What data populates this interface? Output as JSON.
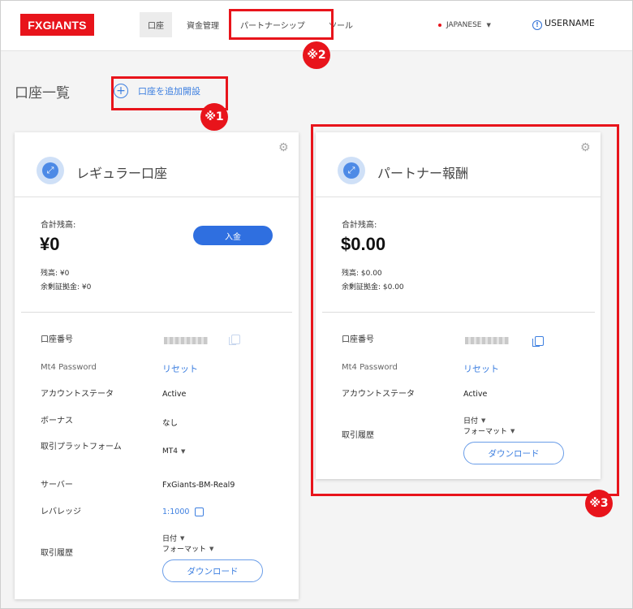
{
  "header": {
    "logo": "FXGIANTS",
    "nav": {
      "account": "口座",
      "funds": "資金管理",
      "partner": "パートナーシップ",
      "tools": "ツール"
    },
    "language": "JAPANESE",
    "username": "USERNAME",
    "info_symbol": "!"
  },
  "page": {
    "title": "口座一覧",
    "add_account": "口座を追加開設"
  },
  "annotations": {
    "one": "※1",
    "two": "※2",
    "three": "※3",
    "color": "#e8141b"
  },
  "regular_account": {
    "title": "レギュラー口座",
    "balance_label": "合計残高:",
    "balance": "¥0",
    "balance_line": "残高: ¥0",
    "margin_line": "余剰証拠金: ¥0",
    "deposit_label": "入金",
    "rows": {
      "account_number_label": "口座番号",
      "password_label": "Mt4 Password",
      "password_action": "リセット",
      "status_label": "アカウントステータ",
      "status_value": "Active",
      "bonus_label": "ボーナス",
      "bonus_value": "なし",
      "platform_label": "取引プラットフォーム",
      "platform_value": "MT4",
      "server_label": "サーバー",
      "server_value": "FxGiants-BM-Real9",
      "leverage_label": "レバレッジ",
      "leverage_value": "1:1000",
      "history_label": "取引履歴",
      "date_option": "日付",
      "format_option": "フォーマット",
      "download_label": "ダウンロード"
    }
  },
  "partner_account": {
    "title": "パートナー報酬",
    "balance_label": "合計残高:",
    "balance": "$0.00",
    "balance_line": "残高: $0.00",
    "margin_line": "余剰証拠金: $0.00",
    "rows": {
      "account_number_label": "口座番号",
      "password_label": "Mt4 Password",
      "password_action": "リセット",
      "status_label": "アカウントステータ",
      "status_value": "Active",
      "history_label": "取引履歴",
      "date_option": "日付",
      "format_option": "フォーマット",
      "download_label": "ダウンロード"
    }
  },
  "colors": {
    "brand_red": "#e8141b",
    "primary_blue": "#2f6fe0",
    "link_blue": "#3d7fe0"
  }
}
